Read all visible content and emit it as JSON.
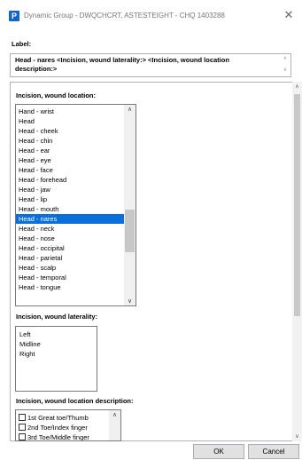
{
  "window": {
    "icon_letter": "P",
    "title": "Dynamic Group - DWQCHCRT, ASTESTEIGHT - CHQ 1403288",
    "close_glyph": "✕"
  },
  "label_section": {
    "heading": "Label:",
    "value": "Head - nares <Incision, wound laterality:> <Incision, wound location description:>"
  },
  "location": {
    "title": "Incision, wound location:",
    "items": [
      "Hand - wrist",
      "Head",
      "Head - cheek",
      "Head - chin",
      "Head - ear",
      "Head - eye",
      "Head - face",
      "Head - forehead",
      "Head - jaw",
      "Head - lip",
      "Head - mouth",
      "Head - nares",
      "Head - neck",
      "Head - nose",
      "Head - occipital",
      "Head - parietal",
      "Head - scalp",
      "Head - temporal",
      "Head - tongue"
    ],
    "selected": "Head - nares"
  },
  "laterality": {
    "title": "Incision, wound laterality:",
    "items": [
      "Left",
      "Midline",
      "Right"
    ]
  },
  "description": {
    "title": "Incision, wound location description:",
    "items": [
      "1st Great toe/Thumb",
      "2nd Toe/Index finger",
      "3rd Toe/Middle finger"
    ]
  },
  "buttons": {
    "ok": "OK",
    "cancel": "Cancel"
  },
  "glyphs": {
    "up": "∧",
    "down": "∨"
  },
  "colors": {
    "selection": "#0a6fd9",
    "app_icon": "#1565c0"
  }
}
